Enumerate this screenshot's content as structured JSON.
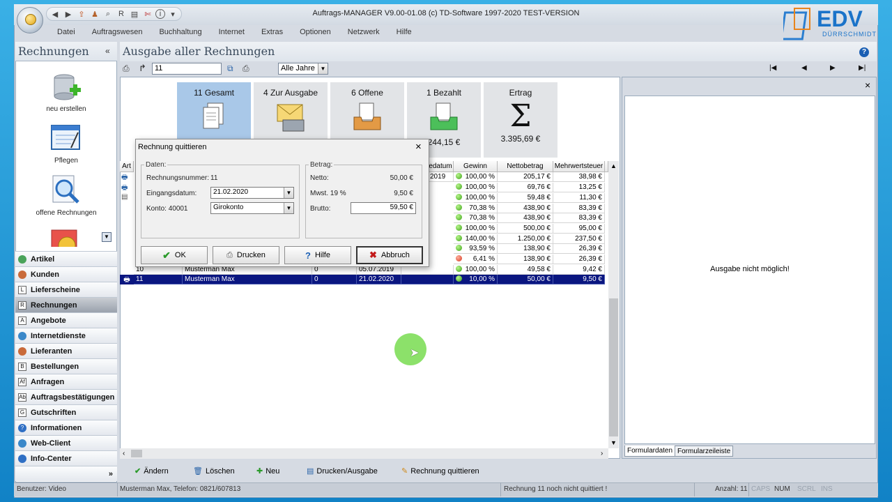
{
  "window": {
    "title": "Auftrags-MANAGER V9.00-01.08 (c) TD-Software 1997-2020 TEST-VERSION",
    "logo_text": "EDV",
    "logo_sub": "DÜRRSCHMIDT"
  },
  "menu": [
    "Datei",
    "Auftragswesen",
    "Buchhaltung",
    "Internet",
    "Extras",
    "Optionen",
    "Netzwerk",
    "Hilfe"
  ],
  "sidebar": {
    "title": "Rechnungen",
    "collapse": "«",
    "actions": [
      {
        "label": "neu erstellen",
        "icon": "database-add-icon"
      },
      {
        "label": "Pflegen",
        "icon": "form-edit-icon"
      },
      {
        "label": "offene Rechnungen",
        "icon": "magnifier-icon"
      }
    ],
    "nav": [
      {
        "label": "Artikel",
        "icon": "A"
      },
      {
        "label": "Kunden",
        "icon": "K"
      },
      {
        "label": "Lieferscheine",
        "icon": "L"
      },
      {
        "label": "Rechnungen",
        "icon": "R"
      },
      {
        "label": "Angebote",
        "icon": "A"
      },
      {
        "label": "Internetdienste",
        "icon": "I"
      },
      {
        "label": "Lieferanten",
        "icon": "L"
      },
      {
        "label": "Bestellungen",
        "icon": "B"
      },
      {
        "label": "Anfragen",
        "icon": "Af"
      },
      {
        "label": "Auftragsbestätigungen",
        "icon": "Ab"
      },
      {
        "label": "Gutschriften",
        "icon": "G"
      },
      {
        "label": "Informationen",
        "icon": "?"
      },
      {
        "label": "Web-Client",
        "icon": "W"
      },
      {
        "label": "Info-Center",
        "icon": "i"
      }
    ],
    "more": "»"
  },
  "main": {
    "title": "Ausgabe aller Rechnungen",
    "search_value": "11",
    "year_filter": "Alle Jahre"
  },
  "tiles": [
    {
      "label": "11 Gesamt",
      "value": ""
    },
    {
      "label": "4 Zur Ausgabe",
      "value": ""
    },
    {
      "label": "6 Offene",
      "value": ""
    },
    {
      "label": "1 Bezahlt",
      "value": "244,15 €"
    },
    {
      "label": "Ertrag",
      "value": "3.395,69 €"
    }
  ],
  "grid": {
    "columns": [
      "Art",
      "edatum",
      "Gewinn",
      "Nettobetrag",
      "Mehrwertsteuer"
    ],
    "rows": [
      {
        "d": "2019",
        "gewinn": "100,00 %",
        "netto": "205,17 €",
        "mwst": "38,98 €",
        "status": "green"
      },
      {
        "d": "",
        "gewinn": "100,00 %",
        "netto": "69,76 €",
        "mwst": "13,25 €",
        "status": "green"
      },
      {
        "d": "",
        "gewinn": "100,00 %",
        "netto": "59,48 €",
        "mwst": "11,30 €",
        "status": "green"
      },
      {
        "d": "",
        "gewinn": "70,38 %",
        "netto": "438,90 €",
        "mwst": "83,39 €",
        "status": "green"
      },
      {
        "d": "",
        "gewinn": "70,38 %",
        "netto": "438,90 €",
        "mwst": "83,39 €",
        "status": "green"
      },
      {
        "d": "",
        "gewinn": "100,00 %",
        "netto": "500,00 €",
        "mwst": "95,00 €",
        "status": "green"
      },
      {
        "d": "",
        "gewinn": "140,00 %",
        "netto": "1.250,00 €",
        "mwst": "237,50 €",
        "status": "green"
      },
      {
        "d": "",
        "gewinn": "93,59 %",
        "netto": "138,90 €",
        "mwst": "26,39 €",
        "status": "green"
      },
      {
        "d": "",
        "gewinn": "6,41 %",
        "netto": "138,90 €",
        "mwst": "26,39 €",
        "status": "red"
      }
    ],
    "row10": {
      "nr": "10",
      "kunde": "Musterman Max",
      "x": "0",
      "datum": "05.07.2019",
      "gewinn": "100,00 %",
      "netto": "49,58 €",
      "mwst": "9,42 €"
    },
    "row11": {
      "nr": "11",
      "kunde": "Musterman Max",
      "x": "0",
      "datum": "21.02.2020",
      "gewinn": "10,00 %",
      "netto": "50,00 €",
      "mwst": "9,50 €"
    }
  },
  "right_panel": {
    "message": "Ausgabe nicht möglich!",
    "close": "×",
    "tabs": [
      "Formulardaten",
      "Formularzeileiste"
    ]
  },
  "bottom_actions": [
    "Ändern",
    "Löschen",
    "Neu",
    "Drucken/Ausgabe",
    "Rechnung quittieren"
  ],
  "status": {
    "user": "Benutzer: Video",
    "customer": "Musterman Max, Telefon: 0821/607813",
    "message": "Rechnung 11 noch nicht quittiert !",
    "count": "Anzahl: 11",
    "caps": "CAPS",
    "num": "NUM",
    "scrl": "SCRL",
    "ins": "INS"
  },
  "dialog": {
    "title": "Rechnung quittieren",
    "close": "×",
    "daten_label": "Daten:",
    "betrag_label": "Betrag:",
    "rnr_label": "Rechnungsnummer:",
    "rnr_value": "11",
    "eingang_label": "Eingangsdatum:",
    "eingang_value": "21.02.2020",
    "konto_label": "Konto: 40001",
    "konto_value": "Girokonto",
    "netto_label": "Netto:",
    "netto_value": "50,00 €",
    "mwst_label": "Mwst. 19 %",
    "mwst_value": "9,50 €",
    "brutto_label": "Brutto:",
    "brutto_value": "59,50 €",
    "buttons": {
      "ok": "OK",
      "drucken": "Drucken",
      "hilfe": "Hilfe",
      "abbruch": "Abbruch"
    }
  }
}
